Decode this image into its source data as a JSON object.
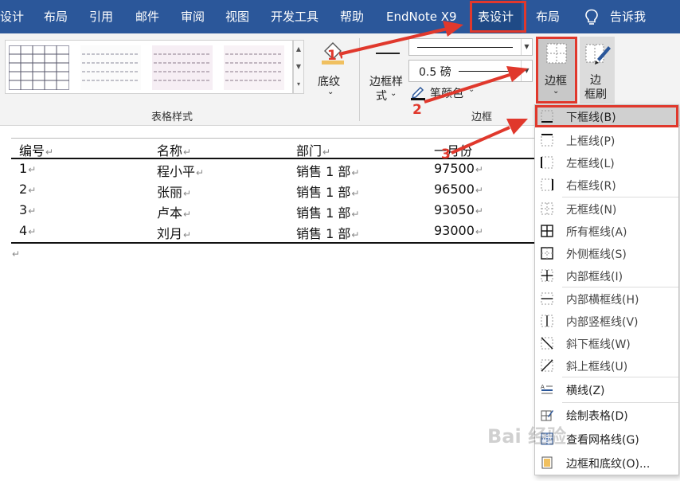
{
  "tabs": [
    {
      "label": "设计",
      "active": false
    },
    {
      "label": "布局",
      "active": false
    },
    {
      "label": "引用",
      "active": false
    },
    {
      "label": "邮件",
      "active": false
    },
    {
      "label": "审阅",
      "active": false
    },
    {
      "label": "视图",
      "active": false
    },
    {
      "label": "开发工具",
      "active": false
    },
    {
      "label": "帮助",
      "active": false
    },
    {
      "label": "EndNote X9",
      "active": false
    },
    {
      "label": "表设计",
      "active": true
    },
    {
      "label": "布局",
      "active": false
    },
    {
      "label": "告诉我",
      "active": false
    }
  ],
  "ribbon": {
    "table_styles_label": "表格样式",
    "shading_label": "底纹",
    "border_styles_label_line1": "边框样",
    "border_styles_label_line2": "式",
    "line_weight_value": "0.5 磅",
    "pen_color_label": "笔颜色",
    "borders_group_label": "边框",
    "borders_button_label": "边框",
    "border_painter_line1": "边",
    "border_painter_line2": "框刷"
  },
  "table": {
    "headers": [
      "编号",
      "名称",
      "部门",
      "一月份"
    ],
    "rows": [
      [
        "1",
        "程小平",
        "销售 1 部",
        "97500"
      ],
      [
        "2",
        "张丽",
        "销售 1 部",
        "96500"
      ],
      [
        "3",
        "卢本",
        "销售 1 部",
        "93050"
      ],
      [
        "4",
        "刘月",
        "销售 1 部",
        "93000"
      ]
    ]
  },
  "menu_items": [
    {
      "label": "下框线(B)",
      "icon": "bottom-border-icon",
      "highlighted": true
    },
    {
      "label": "上框线(P)",
      "icon": "top-border-icon"
    },
    {
      "label": "左框线(L)",
      "icon": "left-border-icon"
    },
    {
      "label": "右框线(R)",
      "icon": "right-border-icon"
    },
    {
      "label": "无框线(N)",
      "icon": "no-border-icon"
    },
    {
      "label": "所有框线(A)",
      "icon": "all-borders-icon"
    },
    {
      "label": "外侧框线(S)",
      "icon": "outside-borders-icon"
    },
    {
      "label": "内部框线(I)",
      "icon": "inside-borders-icon"
    },
    {
      "label": "内部横框线(H)",
      "icon": "inside-horizontal-border-icon"
    },
    {
      "label": "内部竖框线(V)",
      "icon": "inside-vertical-border-icon"
    },
    {
      "label": "斜下框线(W)",
      "icon": "diagonal-down-border-icon"
    },
    {
      "label": "斜上框线(U)",
      "icon": "diagonal-up-border-icon"
    },
    {
      "label": "横线(Z)",
      "icon": "horizontal-line-icon"
    },
    {
      "label": "绘制表格(D)",
      "icon": "draw-table-icon"
    },
    {
      "label": "查看网格线(G)",
      "icon": "view-gridlines-icon"
    },
    {
      "label": "边框和底纹(O)...",
      "icon": "borders-and-shading-icon"
    }
  ],
  "annotations": [
    "1",
    "2",
    "3"
  ],
  "watermark": "Bai 经验",
  "colors": {
    "tab_bar": "#2b579a",
    "annotation": "#e0382c",
    "highlight": "#d0d0d0"
  }
}
